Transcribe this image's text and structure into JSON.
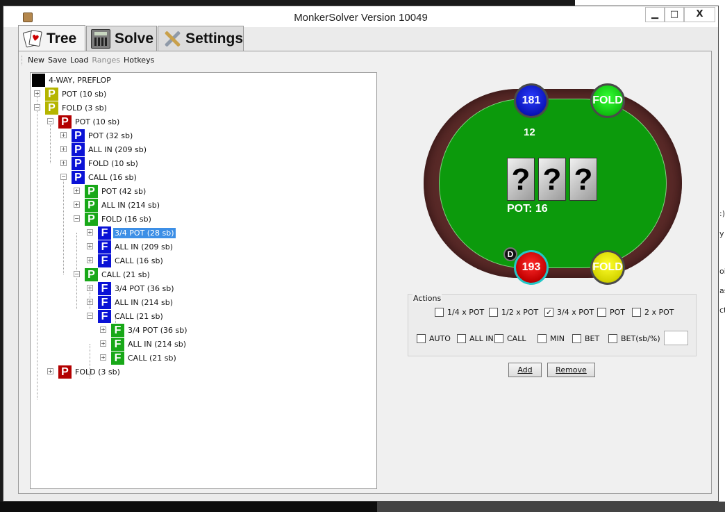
{
  "window": {
    "title": "MonkerSolver Version 10049",
    "min_label": "▁",
    "max_label": "□",
    "close_label": "X"
  },
  "tabs": [
    {
      "label": "Tree"
    },
    {
      "label": "Solve"
    },
    {
      "label": "Settings"
    }
  ],
  "toolbar": {
    "new": "New",
    "save": "Save",
    "load": "Load",
    "ranges": "Ranges",
    "hotkeys": "Hotkeys"
  },
  "tree": {
    "root": "4-WAY, PREFLOP",
    "nodes": [
      {
        "badge": "P",
        "label": "POT (10 sb)"
      },
      {
        "badge": "P",
        "label": "FOLD (3 sb)"
      },
      {
        "badge": "P",
        "label": "POT (10 sb)"
      },
      {
        "badge": "P",
        "label": "POT (32 sb)"
      },
      {
        "badge": "P",
        "label": "ALL IN (209 sb)"
      },
      {
        "badge": "P",
        "label": "FOLD (10 sb)"
      },
      {
        "badge": "P",
        "label": "CALL (16 sb)"
      },
      {
        "badge": "P",
        "label": "POT (42 sb)"
      },
      {
        "badge": "P",
        "label": "ALL IN (214 sb)"
      },
      {
        "badge": "P",
        "label": "FOLD (16 sb)"
      },
      {
        "badge": "F",
        "label": "3/4 POT (28 sb)"
      },
      {
        "badge": "F",
        "label": "ALL IN (209 sb)"
      },
      {
        "badge": "F",
        "label": "CALL (16 sb)"
      },
      {
        "badge": "P",
        "label": "CALL (21 sb)"
      },
      {
        "badge": "F",
        "label": "3/4 POT (36 sb)"
      },
      {
        "badge": "F",
        "label": "ALL IN (214 sb)"
      },
      {
        "badge": "F",
        "label": "CALL (21 sb)"
      },
      {
        "badge": "F",
        "label": "3/4 POT (36 sb)"
      },
      {
        "badge": "F",
        "label": "ALL IN (214 sb)"
      },
      {
        "badge": "F",
        "label": "CALL (21 sb)"
      },
      {
        "badge": "P",
        "label": "FOLD (3 sb)"
      }
    ]
  },
  "table": {
    "seat_top_left": "181",
    "seat_top_right": "FOLD",
    "seat_bottom_left": "193",
    "seat_bottom_right": "FOLD",
    "dealer": "D",
    "bet": "12",
    "cards": [
      "?",
      "?",
      "?"
    ],
    "pot": "POT: 16"
  },
  "actions": {
    "title": "Actions",
    "row1": [
      {
        "label": "1/4 x POT",
        "checked": false
      },
      {
        "label": "1/2 x POT",
        "checked": false
      },
      {
        "label": "3/4 x POT",
        "checked": true
      },
      {
        "label": "POT",
        "checked": false
      },
      {
        "label": "2 x POT",
        "checked": false
      }
    ],
    "row2": [
      {
        "label": "AUTO",
        "checked": false
      },
      {
        "label": "ALL IN",
        "checked": false
      },
      {
        "label": "CALL",
        "checked": false
      },
      {
        "label": "MIN",
        "checked": false
      },
      {
        "label": "BET",
        "checked": false
      },
      {
        "label": "BET(sb/%)",
        "checked": false
      }
    ],
    "bet_value": "",
    "add_label": "Add",
    "remove_label": "Remove"
  },
  "background_edge": {
    "items": [
      ":)",
      "y",
      "oi",
      "as",
      "ct"
    ]
  },
  "colors": {
    "badge_yellow": "#b5b500",
    "badge_red": "#b30000",
    "badge_blue": "#0a12d6",
    "badge_green": "#18a818",
    "selection": "#3d8fe6"
  }
}
